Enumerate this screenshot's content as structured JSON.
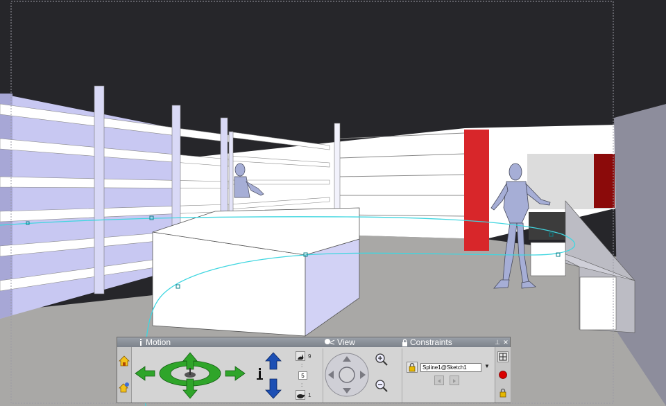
{
  "panel": {
    "motion_label": "Motion",
    "view_label": "View",
    "constraints_label": "Constraints",
    "pin_label": "⊥",
    "close_label": "✕",
    "speed": {
      "max": "9",
      "current": "5",
      "min": "1",
      "dots": ":"
    },
    "constraint_value": "Spline1@Sketch1"
  },
  "icons": {
    "home": "home-icon",
    "home_settings": "home-settings-icon",
    "walk_arrows": "walk-direction-arrows-icon",
    "elevation": "elevation-arrows-icon",
    "rabbit": "fast-rabbit-icon",
    "turtle": "slow-turtle-icon",
    "lookpad": "look-direction-pad-icon",
    "zoom_in": "zoom-in-icon",
    "zoom_out": "zoom-out-icon",
    "lock": "lock-icon",
    "grid": "grid-view-icon",
    "record": "record-icon"
  },
  "colors": {
    "arrow_green": "#2fa52a",
    "elev_blue": "#1c4fb4",
    "spline": "#3fd6e0",
    "record": "#d80000",
    "red_panel": "#d8262a"
  }
}
